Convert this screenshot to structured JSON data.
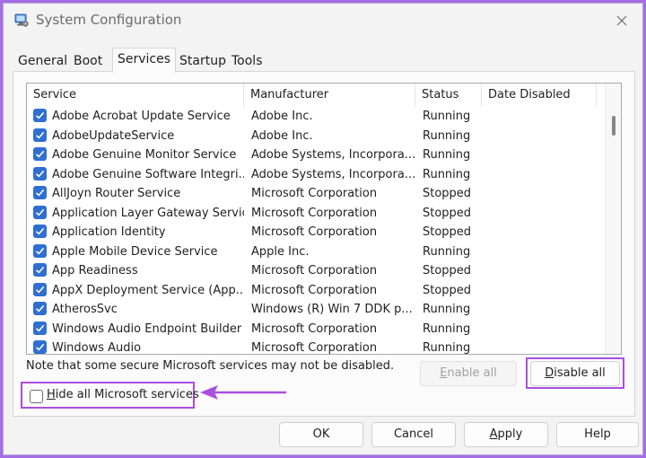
{
  "window": {
    "title": "System Configuration",
    "app_icon": "msconfig-computer-icon",
    "close_icon": "close-icon"
  },
  "tabs": [
    {
      "label": "General",
      "active": false
    },
    {
      "label": "Boot",
      "active": false
    },
    {
      "label": "Services",
      "active": true
    },
    {
      "label": "Startup",
      "active": false
    },
    {
      "label": "Tools",
      "active": false
    }
  ],
  "services_list": {
    "columns": [
      "Service",
      "Manufacturer",
      "Status",
      "Date Disabled"
    ],
    "rows": [
      {
        "checked": true,
        "service": "Adobe Acrobat Update Service",
        "manufacturer": "Adobe Inc.",
        "status": "Running"
      },
      {
        "checked": true,
        "service": "AdobeUpdateService",
        "manufacturer": "Adobe Inc.",
        "status": "Running"
      },
      {
        "checked": true,
        "service": "Adobe Genuine Monitor Service",
        "manufacturer": "Adobe Systems, Incorpora...",
        "status": "Running"
      },
      {
        "checked": true,
        "service": "Adobe Genuine Software Integri...",
        "manufacturer": "Adobe Systems, Incorpora...",
        "status": "Running"
      },
      {
        "checked": true,
        "service": "AllJoyn Router Service",
        "manufacturer": "Microsoft Corporation",
        "status": "Stopped"
      },
      {
        "checked": true,
        "service": "Application Layer Gateway Service",
        "manufacturer": "Microsoft Corporation",
        "status": "Stopped"
      },
      {
        "checked": true,
        "service": "Application Identity",
        "manufacturer": "Microsoft Corporation",
        "status": "Stopped"
      },
      {
        "checked": true,
        "service": "Apple Mobile Device Service",
        "manufacturer": "Apple Inc.",
        "status": "Running"
      },
      {
        "checked": true,
        "service": "App Readiness",
        "manufacturer": "Microsoft Corporation",
        "status": "Stopped"
      },
      {
        "checked": true,
        "service": "AppX Deployment Service (App...",
        "manufacturer": "Microsoft Corporation",
        "status": "Stopped"
      },
      {
        "checked": true,
        "service": "AtherosSvc",
        "manufacturer": "Windows (R) Win 7 DDK p...",
        "status": "Running"
      },
      {
        "checked": true,
        "service": "Windows Audio Endpoint Builder",
        "manufacturer": "Microsoft Corporation",
        "status": "Running"
      },
      {
        "checked": true,
        "service": "Windows Audio",
        "manufacturer": "Microsoft Corporation",
        "status": "Running"
      }
    ]
  },
  "note": "Note that some secure Microsoft services may not be disabled.",
  "buttons": {
    "enable_all": "Enable all",
    "disable_all": "Disable all",
    "ok": "OK",
    "cancel": "Cancel",
    "apply": "Apply",
    "help": "Help"
  },
  "hide_ms": {
    "label": "Hide all Microsoft services",
    "checked": false
  },
  "annotation": {
    "highlight_color": "#a94fe0",
    "arrow_icon": "left-arrow-icon"
  },
  "colors": {
    "accent": "#2f6fd1",
    "backdrop": "#a56ee3"
  }
}
